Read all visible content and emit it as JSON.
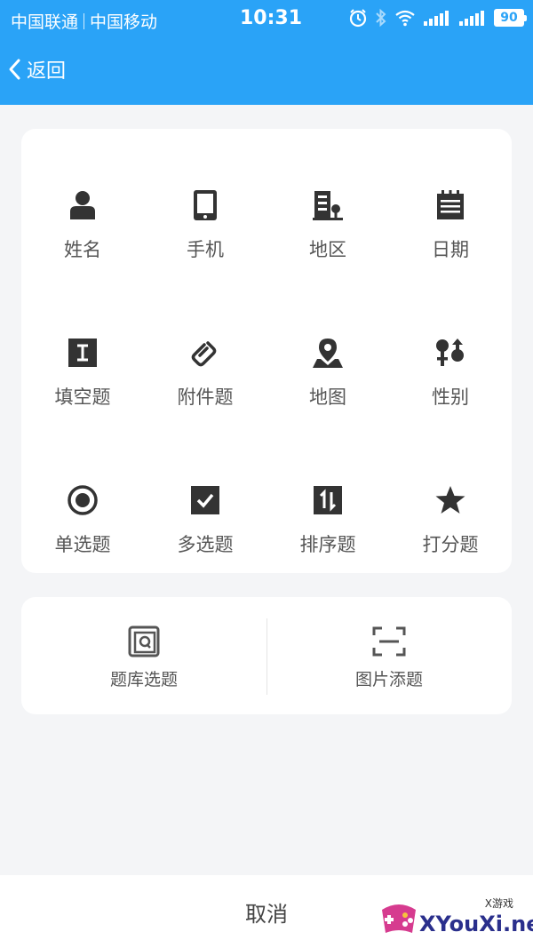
{
  "statusbar": {
    "carrier1": "中国联通",
    "carrier2": "中国移动",
    "time": "10:31",
    "battery": "90"
  },
  "nav": {
    "back_label": "返回"
  },
  "grid": {
    "items": [
      {
        "label": "姓名",
        "icon": "person-icon"
      },
      {
        "label": "手机",
        "icon": "phone-icon"
      },
      {
        "label": "地区",
        "icon": "building-icon"
      },
      {
        "label": "日期",
        "icon": "calendar-icon"
      },
      {
        "label": "填空题",
        "icon": "text-cursor-icon"
      },
      {
        "label": "附件题",
        "icon": "paperclip-icon"
      },
      {
        "label": "地图",
        "icon": "map-pin-icon"
      },
      {
        "label": "性别",
        "icon": "gender-icon"
      },
      {
        "label": "单选题",
        "icon": "radio-icon"
      },
      {
        "label": "多选题",
        "icon": "checkbox-icon"
      },
      {
        "label": "排序题",
        "icon": "sort-icon"
      },
      {
        "label": "打分题",
        "icon": "star-icon"
      }
    ]
  },
  "bank": {
    "left_label": "题库选题",
    "right_label": "图片添题"
  },
  "bottom": {
    "cancel_label": "取消"
  },
  "watermark": {
    "text": "XYouXi.net",
    "small": "X游戏"
  },
  "colors": {
    "accent": "#2aa3f7",
    "icon": "#333333",
    "background": "#f4f5f7"
  }
}
